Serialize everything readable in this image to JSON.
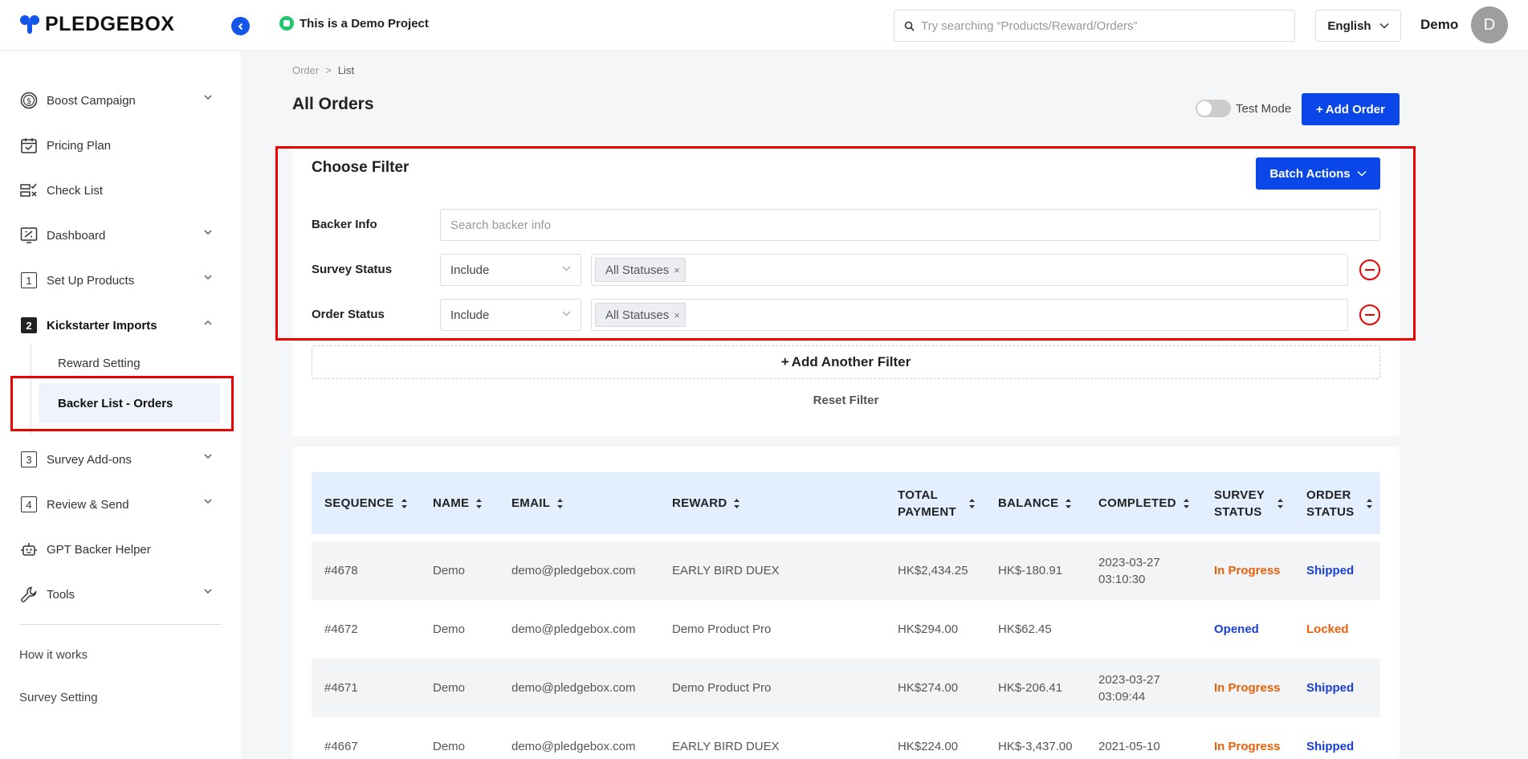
{
  "brand": {
    "name": "PLEDGEBOX"
  },
  "project": {
    "label": "This is a Demo Project"
  },
  "search": {
    "placeholder": "Try searching “Products/Reward/Orders”"
  },
  "language": {
    "selected": "English"
  },
  "user": {
    "name": "Demo",
    "initial": "D"
  },
  "sidebar": {
    "items": [
      {
        "label": "Boost Campaign",
        "icon": "dollar-circle-icon",
        "has_chevron": true
      },
      {
        "label": "Pricing Plan",
        "icon": "calendar-icon",
        "has_chevron": false
      },
      {
        "label": "Check List",
        "icon": "checklist-icon",
        "has_chevron": false
      },
      {
        "label": "Dashboard",
        "icon": "dashboard-icon",
        "has_chevron": true
      },
      {
        "label": "Set Up Products",
        "icon": "step-1-icon",
        "has_chevron": true
      },
      {
        "label": "Kickstarter Imports",
        "icon": "step-2-icon",
        "has_chevron": true
      },
      {
        "label": "Survey Add-ons",
        "icon": "step-3-icon",
        "has_chevron": true
      },
      {
        "label": "Review & Send",
        "icon": "step-4-icon",
        "has_chevron": true
      },
      {
        "label": "GPT Backer Helper",
        "icon": "robot-icon",
        "has_chevron": false
      },
      {
        "label": "Tools",
        "icon": "wrench-icon",
        "has_chevron": true
      }
    ],
    "step_numbers": [
      "1",
      "2",
      "3",
      "4"
    ],
    "sub_items": [
      "Reward Setting",
      "Backer List - Orders"
    ],
    "footer_links": [
      "How it works",
      "Survey Setting"
    ]
  },
  "breadcrumb": {
    "parent": "Order",
    "separator": ">",
    "current": "List"
  },
  "page": {
    "title": "All Orders",
    "test_mode_label": "Test Mode",
    "test_mode_on": false,
    "add_order_label": "Add Order"
  },
  "filter": {
    "title": "Choose Filter",
    "batch_actions_label": "Batch Actions",
    "backer_info_label": "Backer Info",
    "backer_info_placeholder": "Search backer info",
    "survey_status_label": "Survey Status",
    "survey_status_mode": "Include",
    "survey_status_tag": "All Statuses",
    "order_status_label": "Order Status",
    "order_status_mode": "Include",
    "order_status_tag": "All Statuses",
    "add_another_label": "Add Another Filter",
    "reset_label": "Reset Filter"
  },
  "table": {
    "columns": [
      "SEQUENCE",
      "NAME",
      "EMAIL",
      "REWARD",
      "TOTAL PAYMENT",
      "BALANCE",
      "COMPLETED",
      "SURVEY STATUS",
      "ORDER STATUS"
    ],
    "rows": [
      {
        "sequence": "#4678",
        "name": "Demo",
        "email": "demo@pledgebox.com",
        "reward": "EARLY BIRD DUEX",
        "total": "HK$2,434.25",
        "balance": "HK$-180.91",
        "completed": "2023-03-27 03:10:30",
        "survey": "In Progress",
        "order": "Shipped"
      },
      {
        "sequence": "#4672",
        "name": "Demo",
        "email": "demo@pledgebox.com",
        "reward": "Demo Product Pro",
        "total": "HK$294.00",
        "balance": "HK$62.45",
        "completed": "",
        "survey": "Opened",
        "order": "Locked"
      },
      {
        "sequence": "#4671",
        "name": "Demo",
        "email": "demo@pledgebox.com",
        "reward": "Demo Product Pro",
        "total": "HK$274.00",
        "balance": "HK$-206.41",
        "completed": "2023-03-27 03:09:44",
        "survey": "In Progress",
        "order": "Shipped"
      },
      {
        "sequence": "#4667",
        "name": "Demo",
        "email": "demo@pledgebox.com",
        "reward": "EARLY BIRD DUEX",
        "total": "HK$224.00",
        "balance": "HK$-3,437.00",
        "completed": "2021-05-10",
        "survey": "In Progress",
        "order": "Shipped"
      }
    ]
  },
  "colors": {
    "primary": "#0a46e8",
    "status_orange": "#e8600a",
    "status_blue": "#1a3fd6",
    "highlight_red": "#e00000",
    "demo_green": "#1fc66b"
  }
}
